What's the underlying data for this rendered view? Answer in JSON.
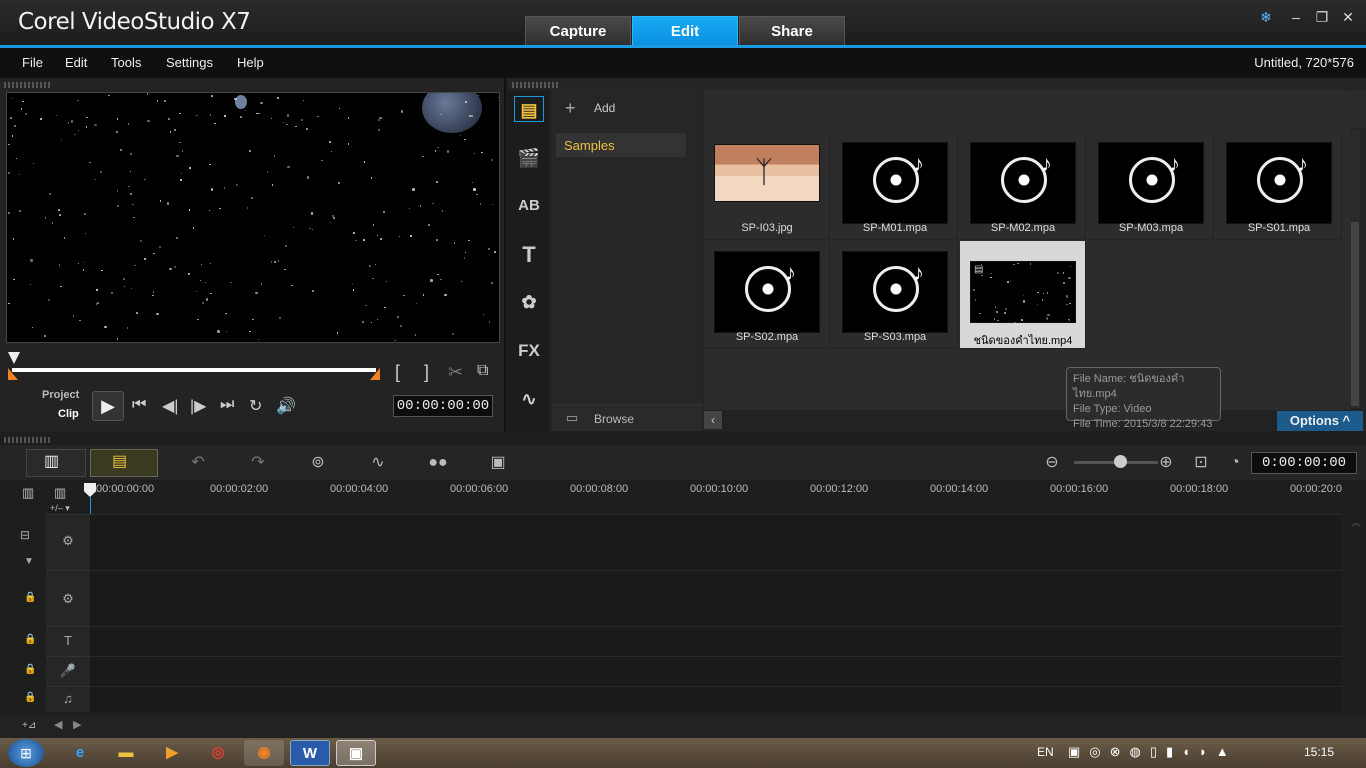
{
  "app": {
    "title": "Corel VideoStudio X7"
  },
  "tabs": [
    {
      "label": "Capture"
    },
    {
      "label": "Edit"
    },
    {
      "label": "Share"
    }
  ],
  "menu": {
    "items": [
      "File",
      "Edit",
      "Tools",
      "Settings",
      "Help"
    ],
    "project_info": "Untitled, 720*576"
  },
  "player": {
    "project_label": "Project",
    "clip_label": "Clip",
    "timecode": "00:00:00:00",
    "mark_in": "[",
    "mark_out": "]"
  },
  "library": {
    "add_label": "Add",
    "folders": [
      "Samples"
    ],
    "browse_label": "Browse",
    "options_label": "Options",
    "items": [
      {
        "name": "SP-I03.jpg",
        "type": "image"
      },
      {
        "name": "SP-M01.mpa",
        "type": "audio"
      },
      {
        "name": "SP-M02.mpa",
        "type": "audio"
      },
      {
        "name": "SP-M03.mpa",
        "type": "audio"
      },
      {
        "name": "SP-S01.mpa",
        "type": "audio"
      },
      {
        "name": "SP-S02.mpa",
        "type": "audio"
      },
      {
        "name": "SP-S03.mpa",
        "type": "audio"
      },
      {
        "name": "ชนิดของคำไทย.mp4",
        "type": "video"
      }
    ],
    "tooltip": {
      "file_name": "File Name: ชนิดของคำไทย.mp4",
      "file_type": "File Type: Video",
      "file_time": "File Time: 2015/3/8 22:29:43"
    }
  },
  "timeline": {
    "timecode": "0:00:00:00",
    "ticks": [
      "00:00:00:00",
      "00:00:02:00",
      "00:00:04:00",
      "00:00:06:00",
      "00:00:08:00",
      "00:00:10:00",
      "00:00:12:00",
      "00:00:14:00",
      "00:00:16:00",
      "00:00:18:00",
      "00:00:20:0"
    ]
  },
  "taskbar": {
    "lang": "EN",
    "clock": "15:15"
  },
  "colors": {
    "accent": "#1a9ae0",
    "folder_highlight": "#f0c040"
  }
}
